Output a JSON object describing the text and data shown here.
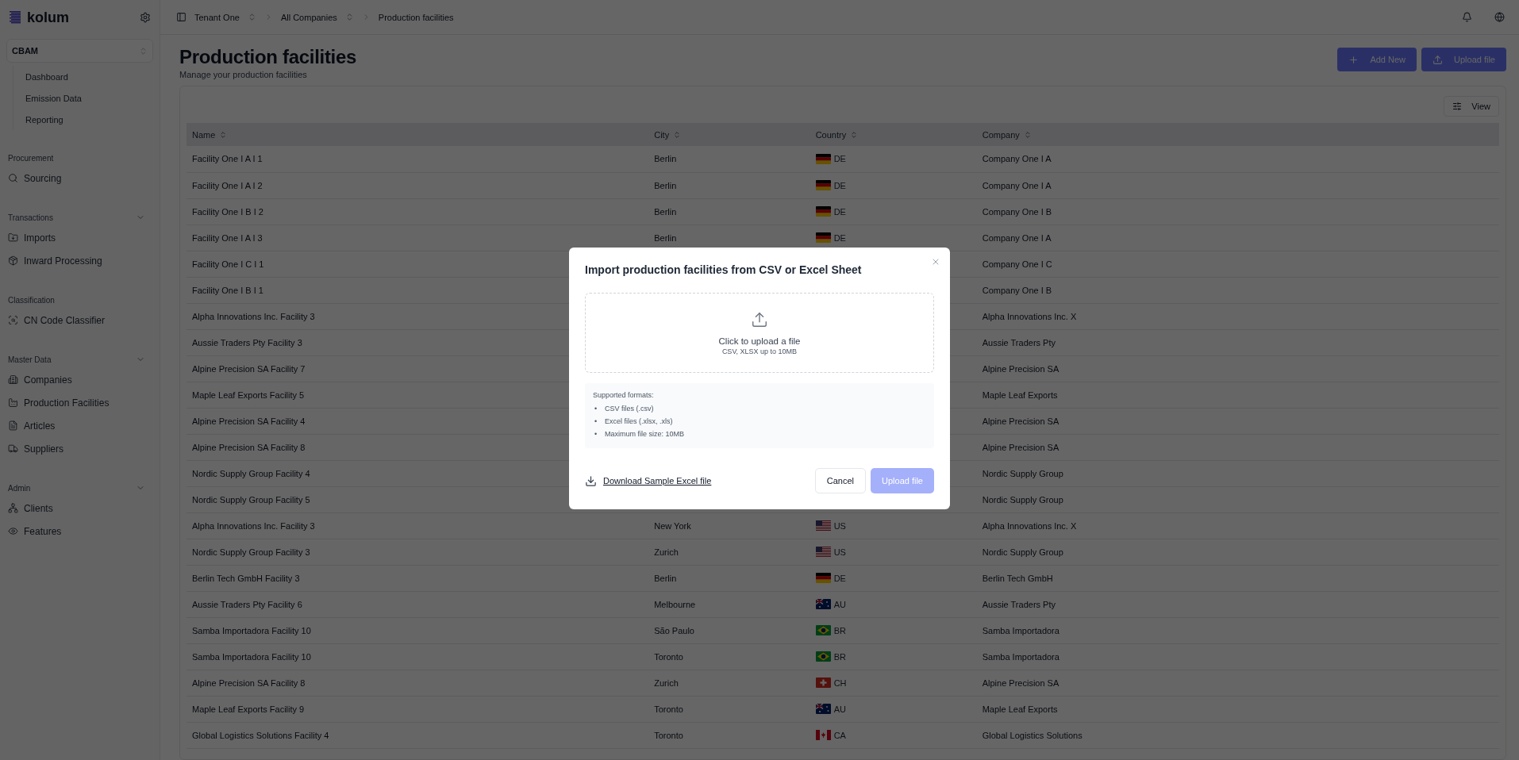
{
  "sidebar": {
    "logo": "kolum",
    "module": "CBAM",
    "module_items": [
      {
        "label": "Dashboard",
        "selected": false
      },
      {
        "label": "Emission Data",
        "selected": false
      },
      {
        "label": "Reporting",
        "selected": false
      }
    ],
    "sections": [
      {
        "title": "Procurement",
        "items": [
          {
            "label": "Sourcing",
            "kind": "search",
            "selected": false
          }
        ]
      },
      {
        "title": "Transactions",
        "expanded": true,
        "items": [
          {
            "label": "Imports",
            "kind": "folder",
            "selected": false
          },
          {
            "label": "Inward Processing",
            "kind": "package",
            "selected": false
          }
        ]
      },
      {
        "title": "Classification",
        "items": [
          {
            "label": "CN Code Classifier",
            "kind": "scan",
            "selected": false
          }
        ]
      },
      {
        "title": "Master Data",
        "expanded": true,
        "items": [
          {
            "label": "Companies",
            "kind": "building",
            "selected": false
          },
          {
            "label": "Production Facilities",
            "kind": "factory",
            "selected": false
          },
          {
            "label": "Articles",
            "kind": "file",
            "selected": false
          },
          {
            "label": "Suppliers",
            "kind": "truck",
            "selected": false
          }
        ]
      },
      {
        "title": "Admin",
        "expanded": true,
        "items": [
          {
            "label": "Clients",
            "kind": "network",
            "selected": false
          },
          {
            "label": "Features",
            "kind": "eye",
            "selected": false
          }
        ]
      }
    ]
  },
  "breadcrumb": [
    {
      "label": "Tenant One",
      "switcher": true
    },
    {
      "label": "All Companies",
      "switcher": true
    },
    {
      "label": "Production facilities",
      "switcher": false
    }
  ],
  "page": {
    "title": "Production facilities",
    "subtitle": "Manage your production facilities",
    "actions": [
      {
        "label": "Add New",
        "kind": "add"
      },
      {
        "label": "Upload file",
        "kind": "upload"
      }
    ]
  },
  "table": {
    "view_button": "View",
    "columns": [
      "Name",
      "City",
      "Country",
      "Company"
    ],
    "rows": [
      {
        "name": "Facility One I A I 1",
        "city": "Berlin",
        "country": {
          "code": "DE",
          "kind": "de"
        },
        "company": "Company One I A"
      },
      {
        "name": "Facility One I A I 2",
        "city": "Berlin",
        "country": {
          "code": "DE",
          "kind": "de"
        },
        "company": "Company One I A"
      },
      {
        "name": "Facility One I B I 2",
        "city": "Berlin",
        "country": {
          "code": "DE",
          "kind": "de"
        },
        "company": "Company One I B"
      },
      {
        "name": "Facility One I A I 3",
        "city": "Berlin",
        "country": {
          "code": "DE",
          "kind": "de"
        },
        "company": "Company One I A"
      },
      {
        "name": "Facility One I C I 1",
        "company": "Company One I C"
      },
      {
        "name": "Facility One I B I 1",
        "company": "Company One I B"
      },
      {
        "name": "Alpha Innovations Inc. Facility 3",
        "company": "Alpha Innovations Inc. X"
      },
      {
        "name": "Aussie Traders Pty Facility 3",
        "company": "Aussie Traders Pty"
      },
      {
        "name": "Alpine Precision SA Facility 7",
        "company": "Alpine Precision SA"
      },
      {
        "name": "Maple Leaf Exports Facility 5",
        "company": "Maple Leaf Exports"
      },
      {
        "name": "Alpine Precision SA Facility 4",
        "company": "Alpine Precision SA"
      },
      {
        "name": "Alpine Precision SA Facility 8",
        "company": "Alpine Precision SA"
      },
      {
        "name": "Nordic Supply Group Facility 4",
        "company": "Nordic Supply Group"
      },
      {
        "name": "Nordic Supply Group Facility 5",
        "company": "Nordic Supply Group"
      },
      {
        "name": "Alpha Innovations Inc. Facility 3",
        "city": "New York",
        "country": {
          "code": "US",
          "kind": "us"
        },
        "company": "Alpha Innovations Inc. X"
      },
      {
        "name": "Nordic Supply Group Facility 3",
        "city": "Zurich",
        "country": {
          "code": "US",
          "kind": "us"
        },
        "company": "Nordic Supply Group"
      },
      {
        "name": "Berlin Tech GmbH Facility 3",
        "city": "Berlin",
        "country": {
          "code": "DE",
          "kind": "de"
        },
        "company": "Berlin Tech GmbH"
      },
      {
        "name": "Aussie Traders Pty Facility 6",
        "city": "Melbourne",
        "country": {
          "code": "AU",
          "kind": "au"
        },
        "company": "Aussie Traders Pty"
      },
      {
        "name": "Samba Importadora Facility 10",
        "city": "São Paulo",
        "country": {
          "code": "BR",
          "kind": "br"
        },
        "company": "Samba Importadora"
      },
      {
        "name": "Samba Importadora Facility 10",
        "city": "Toronto",
        "country": {
          "code": "BR",
          "kind": "br"
        },
        "company": "Samba Importadora"
      },
      {
        "name": "Alpine Precision SA Facility 8",
        "city": "Zurich",
        "country": {
          "code": "CH",
          "kind": "ch"
        },
        "company": "Alpine Precision SA"
      },
      {
        "name": "Maple Leaf Exports Facility 9",
        "city": "Toronto",
        "country": {
          "code": "AU",
          "kind": "au"
        },
        "company": "Maple Leaf Exports"
      },
      {
        "name": "Global Logistics Solutions Facility 4",
        "city": "Toronto",
        "country": {
          "code": "CA",
          "kind": "ca"
        },
        "company": "Global Logistics Solutions"
      }
    ]
  },
  "dialog": {
    "title": "Import production facilities from CSV or Excel Sheet",
    "dropzone": {
      "label": "Click to upload a file",
      "hint": "CSV, XLSX up to 10MB"
    },
    "formats": {
      "title": "Supported formats:",
      "bullet": "•",
      "items": [
        "CSV files (.csv)",
        "Excel files (.xlsx, .xls)",
        "Maximum file size: 10MB"
      ]
    },
    "download_link": "Download Sample Excel file",
    "buttons": [
      {
        "label": "Cancel",
        "kind": "secondary",
        "disabled": false
      },
      {
        "label": "Upload file",
        "kind": "primary",
        "disabled": true
      }
    ]
  }
}
